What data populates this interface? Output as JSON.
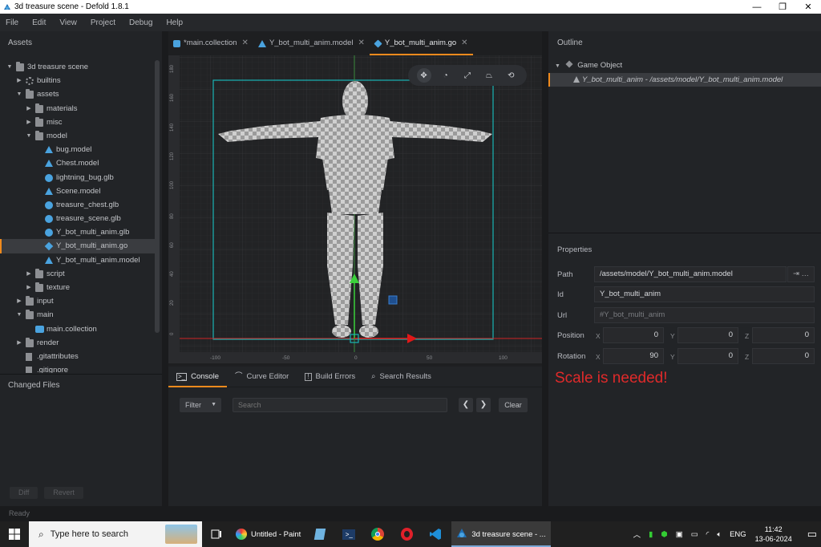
{
  "window": {
    "title": "3d treasure scene - Defold 1.8.1",
    "minimize": "—",
    "restore": "❐",
    "close": "✕"
  },
  "menu": [
    "File",
    "Edit",
    "View",
    "Project",
    "Debug",
    "Help"
  ],
  "assets_panel": {
    "title": "Assets",
    "tree": [
      {
        "label": "3d treasure scene",
        "depth": 0,
        "arrow": "▼",
        "icon": "project-icon"
      },
      {
        "label": "builtins",
        "depth": 1,
        "arrow": "▶",
        "icon": "gear-icon"
      },
      {
        "label": "assets",
        "depth": 1,
        "arrow": "▼",
        "icon": "folder-icon"
      },
      {
        "label": "materials",
        "depth": 2,
        "arrow": "▶",
        "icon": "folder-icon"
      },
      {
        "label": "misc",
        "depth": 2,
        "arrow": "▶",
        "icon": "folder-icon"
      },
      {
        "label": "model",
        "depth": 2,
        "arrow": "▼",
        "icon": "folder-icon"
      },
      {
        "label": "bug.model",
        "depth": 3,
        "arrow": "",
        "icon": "model-icon"
      },
      {
        "label": "Chest.model",
        "depth": 3,
        "arrow": "",
        "icon": "model-icon"
      },
      {
        "label": "lightning_bug.glb",
        "depth": 3,
        "arrow": "",
        "icon": "glb-icon"
      },
      {
        "label": "Scene.model",
        "depth": 3,
        "arrow": "",
        "icon": "model-icon"
      },
      {
        "label": "treasure_chest.glb",
        "depth": 3,
        "arrow": "",
        "icon": "glb-icon"
      },
      {
        "label": "treasure_scene.glb",
        "depth": 3,
        "arrow": "",
        "icon": "glb-icon"
      },
      {
        "label": "Y_bot_multi_anim.glb",
        "depth": 3,
        "arrow": "",
        "icon": "glb-icon"
      },
      {
        "label": "Y_bot_multi_anim.go",
        "depth": 3,
        "arrow": "",
        "icon": "go-icon",
        "selected": true
      },
      {
        "label": "Y_bot_multi_anim.model",
        "depth": 3,
        "arrow": "",
        "icon": "model-icon"
      },
      {
        "label": "script",
        "depth": 2,
        "arrow": "▶",
        "icon": "folder-icon"
      },
      {
        "label": "texture",
        "depth": 2,
        "arrow": "▶",
        "icon": "folder-icon"
      },
      {
        "label": "input",
        "depth": 1,
        "arrow": "▶",
        "icon": "folder-icon"
      },
      {
        "label": "main",
        "depth": 1,
        "arrow": "▼",
        "icon": "folder-icon"
      },
      {
        "label": "main.collection",
        "depth": 2,
        "arrow": "",
        "icon": "collection-icon"
      },
      {
        "label": "render",
        "depth": 1,
        "arrow": "▶",
        "icon": "folder-icon"
      },
      {
        "label": ".gitattributes",
        "depth": 1,
        "arrow": "",
        "icon": "file-icon"
      },
      {
        "label": ".gitignore",
        "depth": 1,
        "arrow": "",
        "icon": "file-icon"
      }
    ]
  },
  "changed_files": {
    "title": "Changed Files",
    "diff": "Diff",
    "revert": "Revert"
  },
  "editor_tabs": [
    {
      "label": "*main.collection",
      "icon": "collection-icon",
      "active": false
    },
    {
      "label": "Y_bot_multi_anim.model",
      "icon": "model-icon",
      "active": false
    },
    {
      "label": "Y_bot_multi_anim.go",
      "icon": "go-icon",
      "active": true
    }
  ],
  "viewport": {
    "y_ticks": [
      "180",
      "160",
      "140",
      "120",
      "100",
      "80",
      "60",
      "40",
      "20",
      "0"
    ],
    "x_ticks": [
      "-100",
      "-50",
      "0",
      "50",
      "100"
    ],
    "tools": [
      "move-tool-icon",
      "rotate-tool-icon",
      "scale-tool-icon",
      "perspective-icon",
      "camera-reset-icon"
    ]
  },
  "bottom_tabs": [
    {
      "label": "Console",
      "icon": "console-icon",
      "active": true
    },
    {
      "label": "Curve Editor",
      "icon": "curve-icon",
      "active": false
    },
    {
      "label": "Build Errors",
      "icon": "errors-icon",
      "active": false
    },
    {
      "label": "Search Results",
      "icon": "search-icon",
      "active": false
    }
  ],
  "console": {
    "filter": "Filter",
    "search_placeholder": "Search",
    "prev": "❮",
    "next": "❯",
    "clear": "Clear"
  },
  "outline": {
    "title": "Outline",
    "root": "Game Object",
    "child": "Y_bot_multi_anim - /assets/model/Y_bot_multi_anim.model"
  },
  "properties": {
    "title": "Properties",
    "path_label": "Path",
    "path_value": "/assets/model/Y_bot_multi_anim.model",
    "id_label": "Id",
    "id_value": "Y_bot_multi_anim",
    "url_label": "Url",
    "url_value": "#Y_bot_multi_anim",
    "position_label": "Position",
    "position": {
      "x": "0",
      "y": "0",
      "z": "0"
    },
    "rotation_label": "Rotation",
    "rotation": {
      "x": "90",
      "y": "0",
      "z": "0"
    },
    "axis_x": "X",
    "axis_y": "Y",
    "axis_z": "Z",
    "path_btn1": "⇥",
    "path_btn2": "…"
  },
  "annotation": "Scale is needed!",
  "status": "Ready",
  "taskbar": {
    "search_placeholder": "Type here to search",
    "apps": [
      {
        "label": "Untitled - Paint",
        "icon": "paint-icon"
      },
      {
        "label": "3d treasure scene - ...",
        "icon": "defold-icon",
        "active": true
      }
    ],
    "lang": "ENG",
    "time": "11:42",
    "date": "13-06-2024"
  }
}
